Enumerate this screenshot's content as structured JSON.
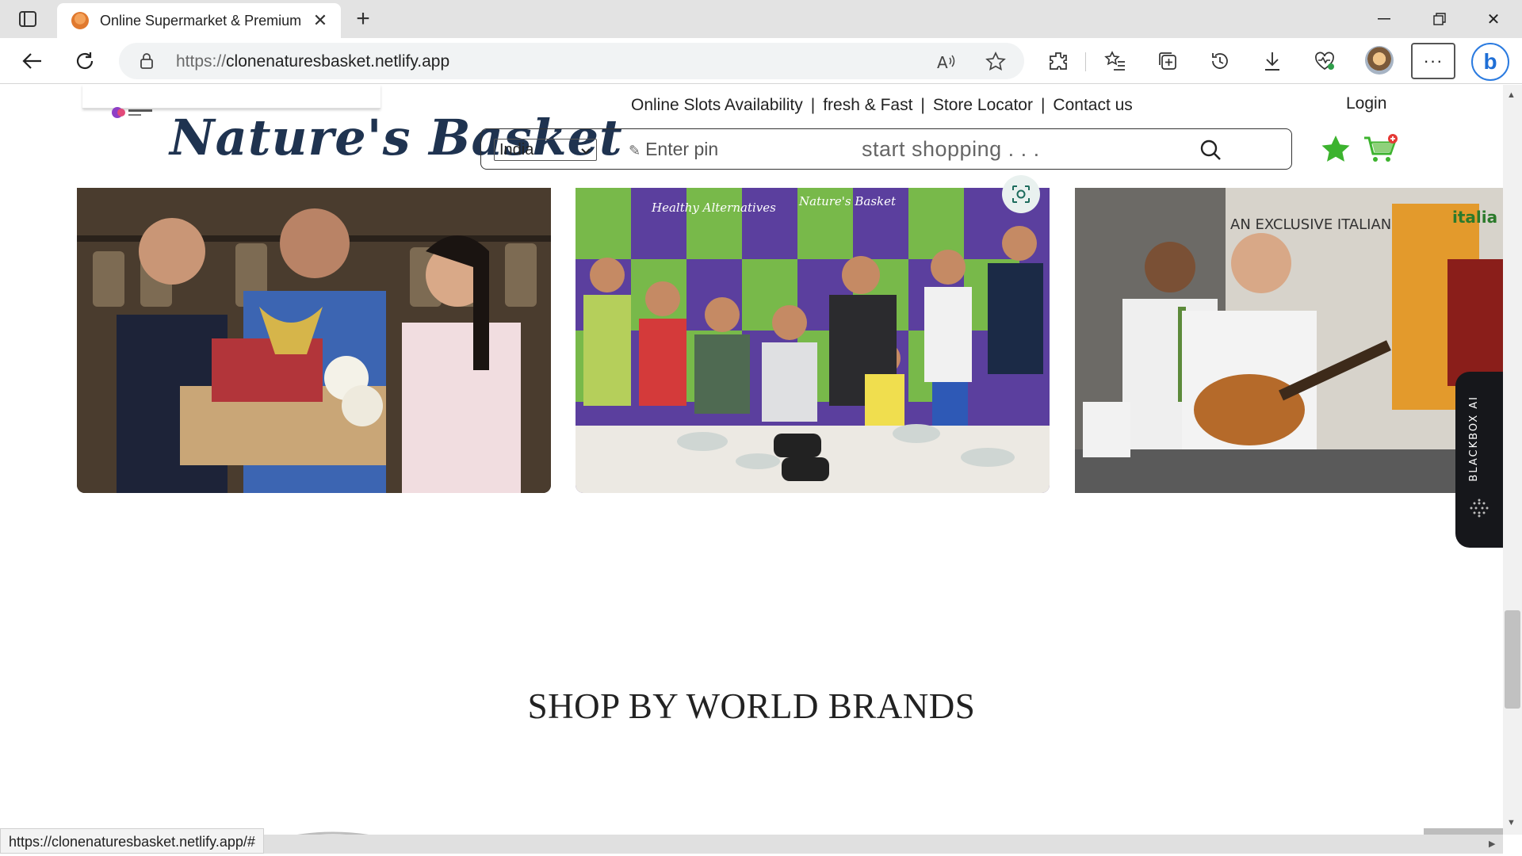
{
  "browser": {
    "tab_title": "Online Supermarket & Premium G",
    "url_protocol": "https://",
    "url_host": "clonenaturesbasket.netlify.app",
    "status_url": "https://clonenaturesbasket.netlify.app/#"
  },
  "header": {
    "top_links": [
      "Online Slots Availability",
      "fresh & Fast",
      "Store Locator",
      "Contact us"
    ],
    "separator": "|",
    "login_label": "Login",
    "logo_text": "Nature's Basket",
    "country_value": "India",
    "pin_placeholder": "Enter pin",
    "search_placeholder": "start shopping . . ."
  },
  "photos": {
    "photo2_banner_1": "Healthy Alternatives",
    "photo2_banner_2": "Nature's Basket",
    "photo3_banner_1": "AN EXCLUSIVE ITALIAN CULINARY",
    "photo3_banner_2": "italia"
  },
  "blackbox_label": "BLACKBOX AI",
  "section_title": "SHOP BY WORLD BRANDS",
  "colors": {
    "logo": "#1f3350",
    "star": "#3cb32e",
    "cart": "#3cb32e",
    "cart_badge": "#e53935",
    "blackbox_bg": "#16171b"
  }
}
